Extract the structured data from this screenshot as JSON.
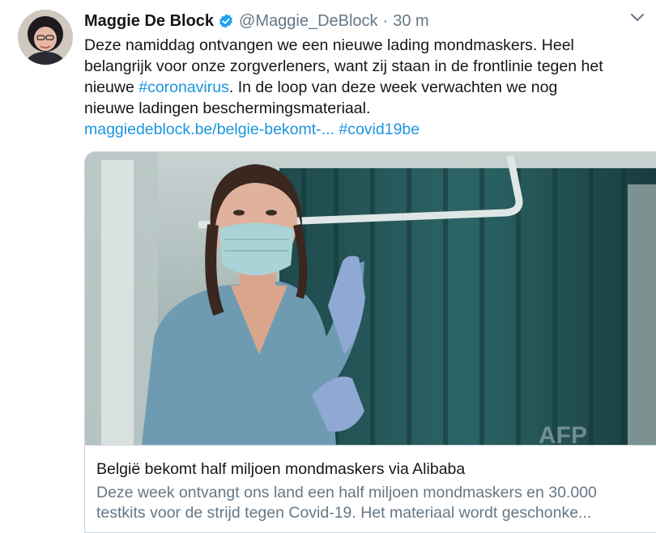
{
  "tweet": {
    "author_name": "Maggie De Block",
    "handle": "@Maggie_DeBlock",
    "separator": "·",
    "time": "30 m",
    "avatar_icon": "avatar-photo",
    "verified_icon": "verified-badge-icon",
    "more_icon": "chevron-down-icon",
    "text_lines": [
      "Deze namiddag ontvangen we een nieuwe lading mondmaskers. Heel",
      "belangrijk voor onze zorgverleners, want zij staan in de frontlinie tegen het"
    ],
    "line3_prefix": "nieuwe ",
    "hashtag_coronavirus": "#coronavirus",
    "line3_suffix": ". In de loop van deze week verwachten we nog",
    "line4": "nieuwe ladingen beschermingsmateriaal.",
    "link_url": "maggiedeblock.be/belgie-bekomt-...",
    "hashtag_covid": "#covid19be"
  },
  "card": {
    "image_icon": "nurse-with-mask-photo",
    "title": "België bekomt half miljoen mondmaskers via Alibaba",
    "desc_line1": "Deze week ontvangt ons land een half miljoen mondmaskers en 30.000",
    "desc_line2": "testkits voor de strijd tegen Covid-19. Het materiaal wordt geschonke..."
  },
  "colors": {
    "link": "#1b95e0",
    "text": "#14171a",
    "secondary": "#657786",
    "border": "#ccd6dd"
  }
}
